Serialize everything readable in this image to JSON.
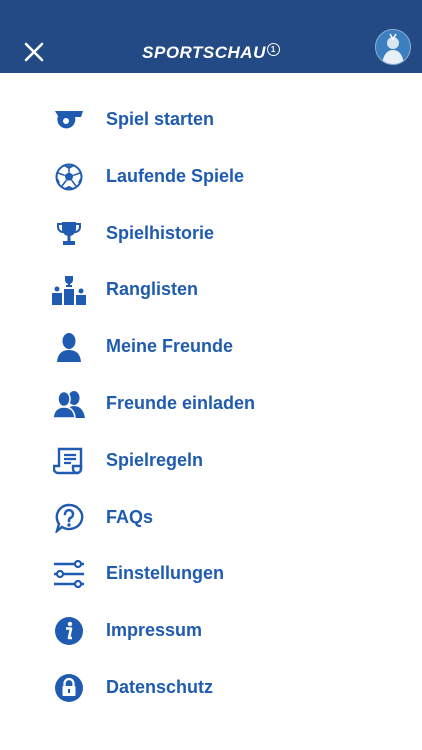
{
  "header": {
    "brand": "SPORTSCHAU",
    "brand_mark": "1",
    "accent_color": "#244a86",
    "close_icon": "close-icon",
    "avatar_icon": "avatar"
  },
  "menu": {
    "color": "#1f5bb0",
    "items": [
      {
        "label": "Spiel starten",
        "icon": "whistle-icon"
      },
      {
        "label": "Laufende Spiele",
        "icon": "soccer-ball-icon"
      },
      {
        "label": "Spielhistorie",
        "icon": "trophy-icon"
      },
      {
        "label": "Ranglisten",
        "icon": "podium-icon"
      },
      {
        "label": "Meine Freunde",
        "icon": "person-icon"
      },
      {
        "label": "Freunde einladen",
        "icon": "people-icon"
      },
      {
        "label": "Spielregeln",
        "icon": "rules-scroll-icon"
      },
      {
        "label": "FAQs",
        "icon": "question-bubble-icon"
      },
      {
        "label": "Einstellungen",
        "icon": "sliders-icon"
      },
      {
        "label": "Impressum",
        "icon": "info-icon"
      },
      {
        "label": "Datenschutz",
        "icon": "lock-icon"
      }
    ]
  }
}
